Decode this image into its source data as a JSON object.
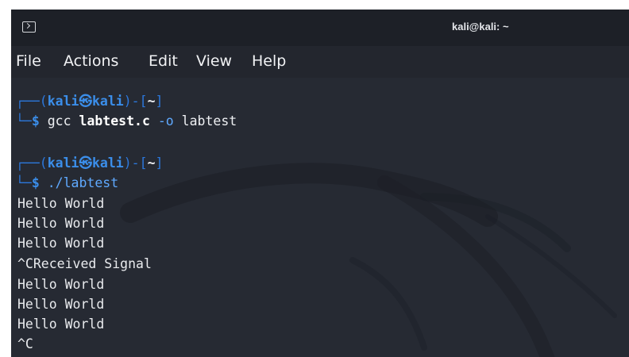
{
  "window": {
    "title": "kali@kali: ~",
    "icon": "terminal-icon"
  },
  "menubar": {
    "items": [
      "File",
      "Actions",
      "Edit",
      "View",
      "Help"
    ]
  },
  "prompt": {
    "box_top": "┌──(",
    "user": "kali",
    "at_symbol": "㉿",
    "host": "kali",
    "mid": ")-[",
    "cwd": "~",
    "close": "]",
    "box_bottom": "└─",
    "dollar": "$"
  },
  "commands": [
    {
      "program": "gcc",
      "file": "labtest.c",
      "flag": "-o",
      "arg": "labtest"
    },
    {
      "program": "./labtest"
    }
  ],
  "output": [
    "Hello World",
    "Hello World",
    "Hello World",
    "^CReceived Signal",
    "Hello World",
    "Hello World",
    "Hello World",
    "^C"
  ],
  "colors": {
    "background": "#262a33",
    "prompt_blue": "#3b8eea",
    "box_blue": "#2c78dc",
    "text": "#eef0f3"
  }
}
